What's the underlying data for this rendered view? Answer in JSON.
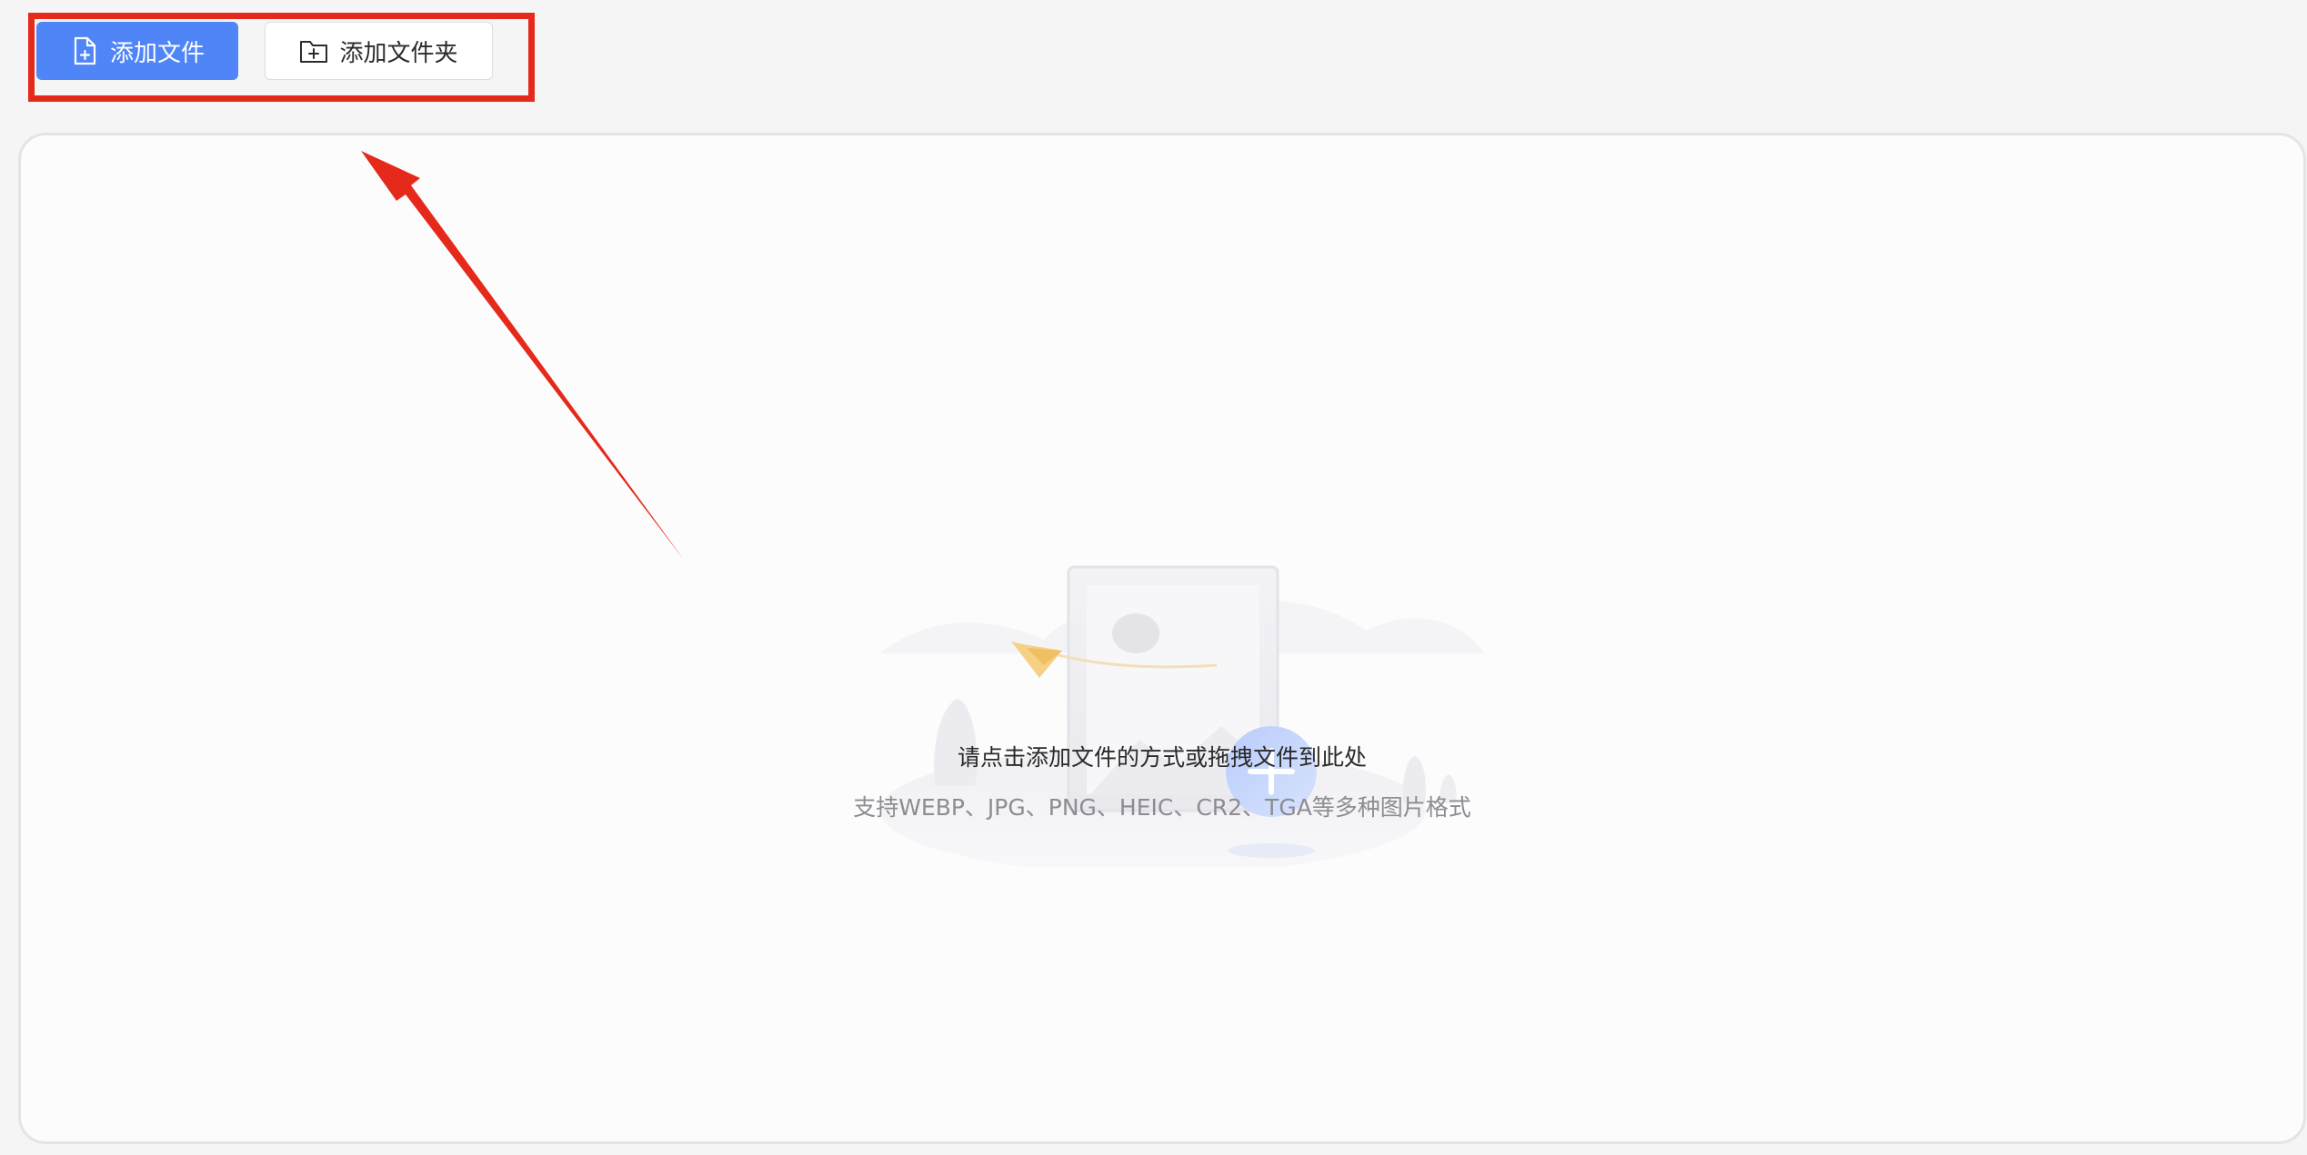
{
  "toolbar": {
    "add_file_label": "添加文件",
    "add_folder_label": "添加文件夹",
    "add_file_icon": "file-plus-icon",
    "add_folder_icon": "folder-plus-icon"
  },
  "drop_area": {
    "title": "请点击添加文件的方式或拖拽文件到此处",
    "subtitle": "支持WEBP、JPG、PNG、HEIC、CR2、TGA等多种图片格式",
    "illustration_icon": "image-upload-illustration",
    "plus_icon": "plus-circle-icon"
  },
  "annotations": {
    "highlight": "red-highlight-box",
    "arrow": "red-arrow"
  },
  "colors": {
    "primary": "#4f85f6",
    "annotation_red": "#e5291b",
    "background": "#f5f5f6",
    "panel": "#fcfcfd"
  }
}
